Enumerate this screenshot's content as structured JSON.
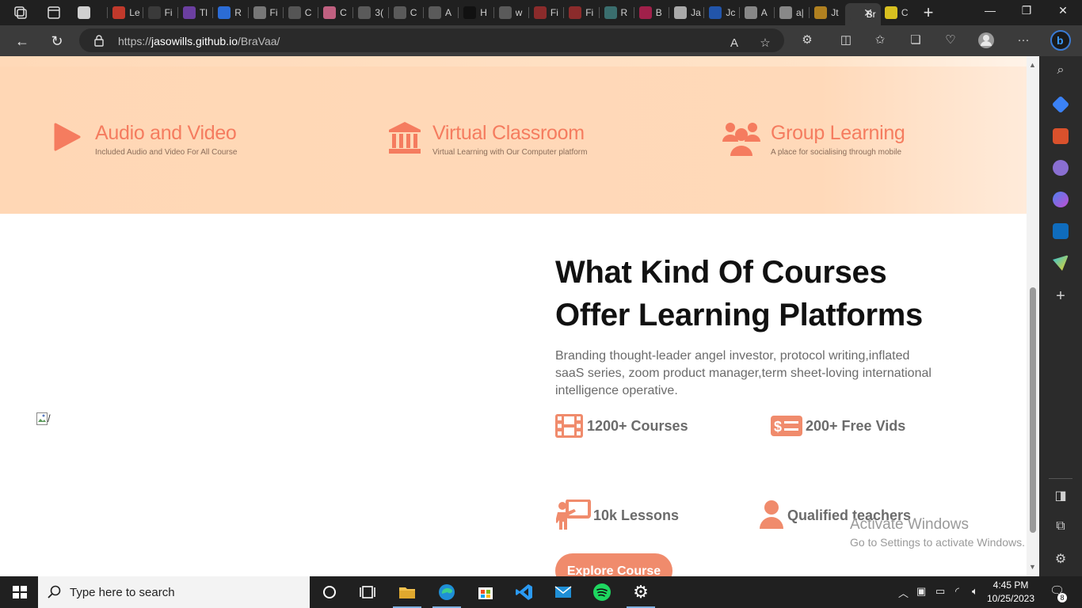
{
  "browser": {
    "tabs": [
      {
        "label": "",
        "color": "#d0d0d0"
      },
      {
        "label": "Le",
        "color": "#c0392b"
      },
      {
        "label": "Fi",
        "color": "#3a3a3a"
      },
      {
        "label": "Tl",
        "color": "#6b3fa0"
      },
      {
        "label": "R",
        "color": "#2b6cd6"
      },
      {
        "label": "Fi",
        "color": "#777"
      },
      {
        "label": "C",
        "color": "#555"
      },
      {
        "label": "C",
        "color": "#c06080"
      },
      {
        "label": "3(",
        "color": "#5a5a5a"
      },
      {
        "label": "C",
        "color": "#5a5a5a"
      },
      {
        "label": "A",
        "color": "#5a5a5a"
      },
      {
        "label": "H",
        "color": "#111"
      },
      {
        "label": "w",
        "color": "#5a5a5a"
      },
      {
        "label": "Fi",
        "color": "#8b2b2b"
      },
      {
        "label": "Fi",
        "color": "#8b2b2b"
      },
      {
        "label": "R",
        "color": "#3a6e6e"
      },
      {
        "label": "B",
        "color": "#a0204a"
      },
      {
        "label": "Ja",
        "color": "#aaa"
      },
      {
        "label": "Jc",
        "color": "#2255aa"
      },
      {
        "label": "A",
        "color": "#888"
      },
      {
        "label": "a|",
        "color": "#888"
      },
      {
        "label": "Jt",
        "color": "#b08020"
      },
      {
        "label": "Br",
        "color": "#3b3b3b"
      },
      {
        "label": "C",
        "color": "#d8c020"
      }
    ],
    "url_prefix": "https://",
    "url_host": "jasowills.github.io",
    "url_path": "/BraVaa/"
  },
  "features": [
    {
      "title": "Audio and Video",
      "subtitle": "Included Audio and Video For All Course",
      "icon": "play-icon"
    },
    {
      "title": "Virtual Classroom",
      "subtitle": "Virtual Learning with Our Computer platform",
      "icon": "classroom-icon"
    },
    {
      "title": "Group Learning",
      "subtitle": "A place for socialising through mobile",
      "icon": "group-icon"
    }
  ],
  "courses": {
    "heading_line1": "What Kind Of Courses",
    "heading_line2": "Offer Learning Platforms",
    "description": "Branding thought-leader angel investor, protocol writing,inflated saaS series, zoom product manager,term sheet-loving international intelligence operative.",
    "image_alt": "/",
    "stats": [
      {
        "label": "1200+ Courses",
        "icon": "film-icon"
      },
      {
        "label": "200+ Free Vids",
        "icon": "money-icon"
      },
      {
        "label": "10k Lessons",
        "icon": "teacher-icon"
      },
      {
        "label": "Qualified teachers",
        "icon": "user-icon"
      }
    ],
    "button_label": "Explore Course"
  },
  "watermark": {
    "line1": "Activate Windows",
    "line2": "Go to Settings to activate Windows."
  },
  "taskbar": {
    "search_placeholder": "Type here to search",
    "time": "4:45 PM",
    "date": "10/25/2023",
    "notification_count": "8"
  },
  "colors": {
    "accent": "#f57c5f",
    "band": "#ffd7b5",
    "button": "#f08b6c"
  }
}
